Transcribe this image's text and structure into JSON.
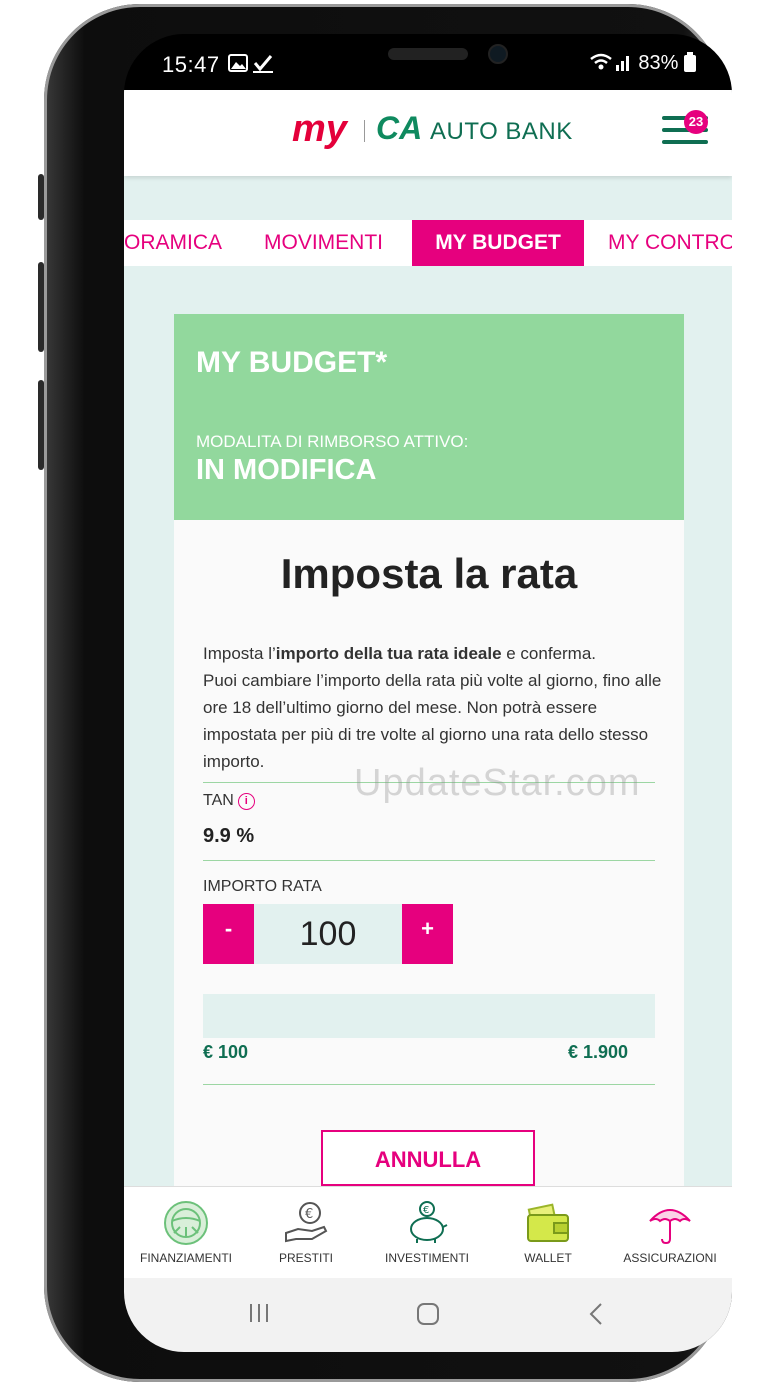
{
  "status_bar": {
    "time": "15:47",
    "battery": "83%"
  },
  "header": {
    "logo_my": "my",
    "logo_ca": "CA",
    "logo_brand": "AUTO BANK",
    "menu_badge": "23"
  },
  "tabs": [
    {
      "label": "ORAMICA"
    },
    {
      "label": "MOVIMENTI"
    },
    {
      "label": "MY BUDGET",
      "active": true
    },
    {
      "label": "MY CONTRO"
    }
  ],
  "card": {
    "title": "MY BUDGET*",
    "subtitle": "MODALITA DI RIMBORSO ATTIVO:",
    "status": "IN MODIFICA"
  },
  "rate": {
    "heading": "Imposta la rata",
    "intro_pre": "Imposta l’",
    "intro_bold": "importo della tua rata ideale",
    "intro_post": " e conferma.",
    "intro_rest": "Puoi cambiare l’importo della rata più volte al giorno, fino alle ore 18 dell’ultimo giorno del mese. Non potrà essere impostata per più di tre volte al giorno una rata dello stesso importo.",
    "tan_label": "TAN",
    "tan_value": "9.9 %",
    "amount_label": "IMPORTO RATA",
    "minus": "-",
    "plus": "+",
    "amount_value": "100",
    "range_min": "€ 100",
    "range_max": "€ 1.900",
    "cancel": "ANNULLA"
  },
  "watermark": "UpdateStar.com",
  "bottom_nav": [
    {
      "label": "FINANZIAMENTI",
      "icon": "steering-wheel-icon"
    },
    {
      "label": "PRESTITI",
      "icon": "hand-euro-icon"
    },
    {
      "label": "INVESTIMENTI",
      "icon": "piggy-bank-icon"
    },
    {
      "label": "WALLET",
      "icon": "wallet-icon"
    },
    {
      "label": "ASSICURAZIONI",
      "icon": "umbrella-icon"
    }
  ],
  "colors": {
    "accent": "#e6007e",
    "green": "#0f6e52",
    "card_green": "#92d89d",
    "bg_mint": "#e2f1ef"
  }
}
